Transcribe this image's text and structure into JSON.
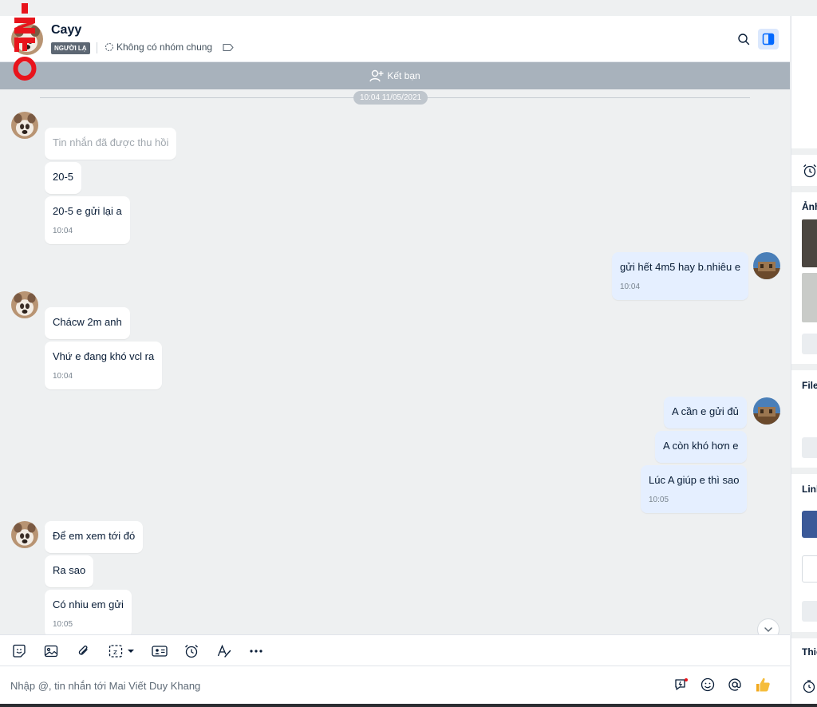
{
  "header": {
    "name": "Cayy",
    "badge": "NGƯỜI LẠ",
    "groups": "Không có nhóm chung"
  },
  "friend_bar": {
    "label": "Kết bạn"
  },
  "date_divider": "10:04 11/05/2021",
  "messages": [
    {
      "dir": "in",
      "text": "Tin nhắn đã được thu hồi",
      "time": ""
    },
    {
      "dir": "in",
      "text": "20-5",
      "time": ""
    },
    {
      "dir": "in",
      "text": "20-5 e gửi lại a",
      "time": "10:04"
    },
    {
      "dir": "out",
      "text": "gửi hết 4m5 hay b.nhiêu e",
      "time": "10:04"
    },
    {
      "dir": "in",
      "text": "Chácw 2m anh",
      "time": ""
    },
    {
      "dir": "in",
      "text": "Vhứ e đang khó vcl ra",
      "time": "10:04"
    },
    {
      "dir": "out",
      "text": "A cần e gửi đủ",
      "time": ""
    },
    {
      "dir": "out",
      "text": "A còn khó hơn e",
      "time": ""
    },
    {
      "dir": "out",
      "text": "Lúc A giúp e thì sao",
      "time": "10:05"
    },
    {
      "dir": "in",
      "text": "Để em xem tới đó",
      "time": ""
    },
    {
      "dir": "in",
      "text": "Ra sao",
      "time": ""
    },
    {
      "dir": "in",
      "text": "Có nhiu em gửi",
      "time": "10:05"
    }
  ],
  "composer": {
    "placeholder": "Nhập @, tin nhắn tới Mai Viết Duy Khang"
  },
  "right_panel": {
    "photos_title": "Ảnh",
    "files_title": "File",
    "links_title": "Link",
    "settings_title": "Thiết"
  },
  "colors": {
    "accent": "#0068ff",
    "outgoing_bubble": "#e5efff",
    "incoming_bubble": "#ffffff",
    "friend_bar": "#a8b2bc",
    "watermark": "#e8141c"
  }
}
